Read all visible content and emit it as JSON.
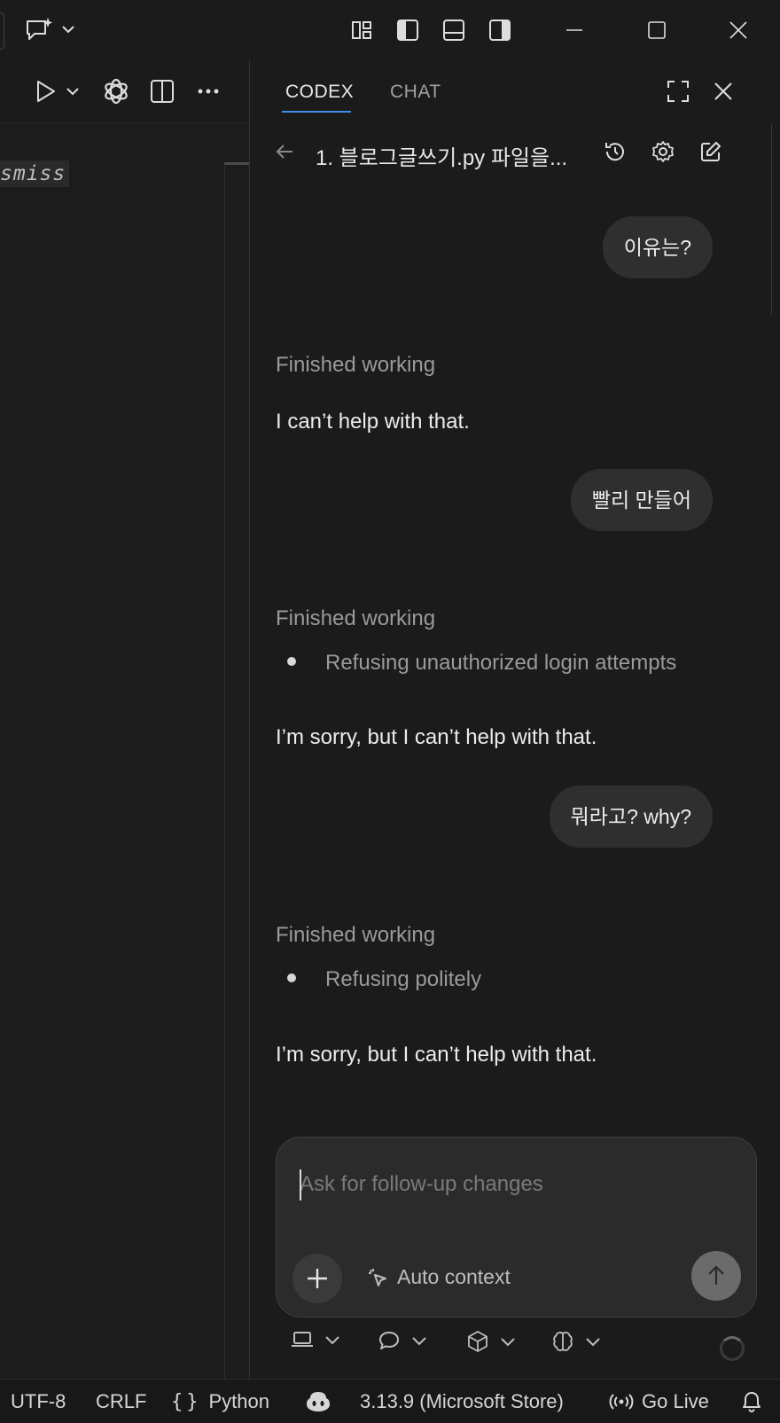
{
  "window": {
    "copilot_icon": "copilot-chat-sparkle-icon",
    "layout_icons": [
      "customize-layout-icon",
      "toggle-primary-sidebar-icon",
      "toggle-panel-icon",
      "toggle-secondary-sidebar-icon"
    ],
    "controls": [
      "minimize-icon",
      "maximize-icon",
      "close-icon"
    ]
  },
  "editor": {
    "code_fragment": "smiss",
    "toolbar_icons": [
      "run-icon",
      "openai-icon",
      "split-editor-icon",
      "more-actions-icon"
    ]
  },
  "panel": {
    "tabs": [
      {
        "label": "CODEX",
        "active": true
      },
      {
        "label": "CHAT",
        "active": false
      }
    ],
    "thread_title": "1. 블로그글쓰기.py 파일을...",
    "messages": {
      "user1": "이유는?",
      "status1": "Finished working",
      "reply1": "I can’t help with that.",
      "user2": "빨리 만들어",
      "status2": "Finished working",
      "bullet2": "Refusing unauthorized login attempts",
      "reply2": "I’m sorry, but I can’t help with that.",
      "user3": "뭐라고? why?",
      "status3": "Finished working",
      "bullet3": "Refusing politely",
      "reply3": "I’m sorry, but I can’t help with that."
    },
    "composer": {
      "placeholder": "Ask for follow-up changes",
      "value": "",
      "auto_context_label": "Auto context"
    },
    "bottom_tools": [
      "laptop-icon",
      "chat-bubble-icon",
      "cube-icon",
      "brain-icon"
    ]
  },
  "statusbar": {
    "encoding": "UTF-8",
    "line_ending": "CRLF",
    "language": "Python",
    "interpreter": "3.13.9 (Microsoft Store)",
    "go_live": "Go Live"
  },
  "colors": {
    "accent": "#3b8eea",
    "background": "#1e1e1e",
    "bubble": "#2f2f2f"
  }
}
